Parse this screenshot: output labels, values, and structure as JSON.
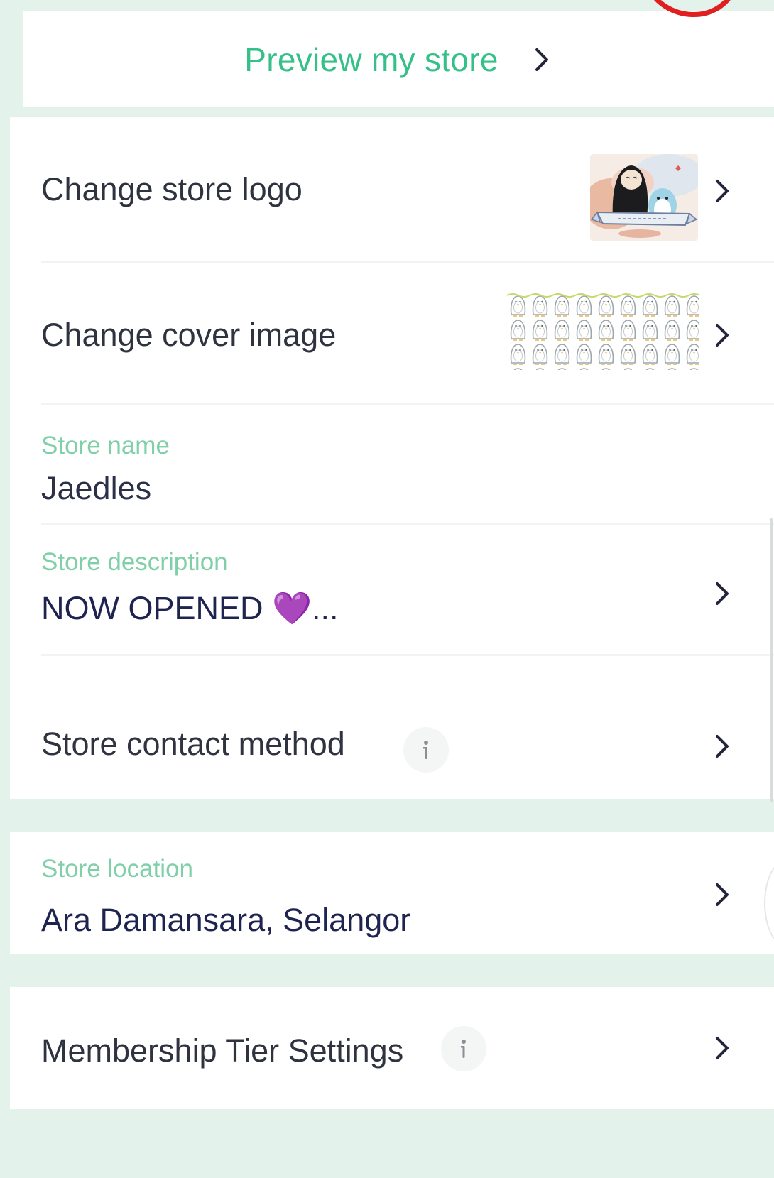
{
  "preview": {
    "label": "Preview my store"
  },
  "rows": {
    "logo": {
      "title": "Change store logo"
    },
    "cover": {
      "title": "Change cover image"
    },
    "store_name": {
      "label": "Store name",
      "value": "Jaedles"
    },
    "store_description": {
      "label": "Store description",
      "value": "NOW OPENED 💜..."
    },
    "contact": {
      "title": "Store contact method"
    },
    "location": {
      "label": "Store location",
      "value": "Ara Damansara, Selangor"
    },
    "membership": {
      "title": "Membership Tier Settings"
    }
  },
  "icons": {
    "chevron": "chevron-right-icon",
    "info": "info-icon"
  },
  "colors": {
    "accent_green": "#35c089",
    "label_green": "#7fcfa8",
    "section_bg": "#e3f2eb",
    "text_dark": "#2f3340",
    "annotation_red": "#e02020"
  }
}
